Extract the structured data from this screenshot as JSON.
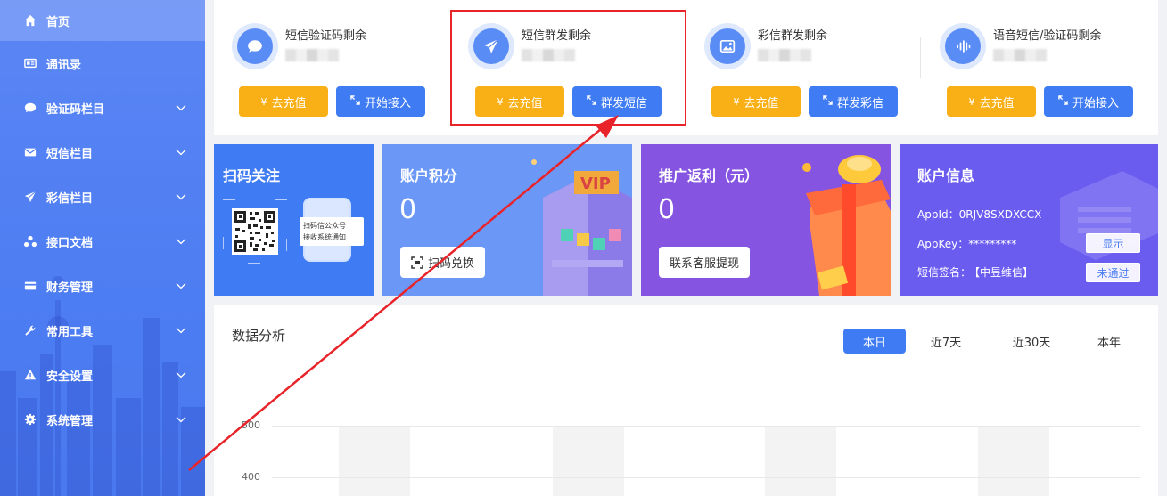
{
  "sidebar": {
    "items": [
      {
        "label": "首页",
        "icon": "home-icon",
        "active": true,
        "has_chevron": false
      },
      {
        "label": "通讯录",
        "icon": "contact-card-icon",
        "active": false,
        "has_chevron": false
      },
      {
        "label": "验证码栏目",
        "icon": "chat-bubble-icon",
        "active": false,
        "has_chevron": true
      },
      {
        "label": "短信栏目",
        "icon": "envelope-icon",
        "active": false,
        "has_chevron": true
      },
      {
        "label": "彩信栏目",
        "icon": "paper-plane-icon",
        "active": false,
        "has_chevron": true
      },
      {
        "label": "接口文档",
        "icon": "network-icon",
        "active": false,
        "has_chevron": true
      },
      {
        "label": "财务管理",
        "icon": "credit-card-icon",
        "active": false,
        "has_chevron": true
      },
      {
        "label": "常用工具",
        "icon": "wrench-icon",
        "active": false,
        "has_chevron": true
      },
      {
        "label": "安全设置",
        "icon": "warning-icon",
        "active": false,
        "has_chevron": true
      },
      {
        "label": "系统管理",
        "icon": "gear-icon",
        "active": false,
        "has_chevron": true
      }
    ]
  },
  "balances": [
    {
      "title": "短信验证码剩余",
      "icon": "chat-bubble-icon",
      "recharge_label": "去充值",
      "action_label": "开始接入"
    },
    {
      "title": "短信群发剩余",
      "icon": "paper-plane-icon",
      "recharge_label": "去充值",
      "action_label": "群发短信"
    },
    {
      "title": "彩信群发剩余",
      "icon": "image-icon",
      "recharge_label": "去充值",
      "action_label": "群发彩信"
    },
    {
      "title": "语音短信/验证码剩余",
      "icon": "voice-wave-icon",
      "recharge_label": "去充值",
      "action_label": "开始接入"
    }
  ],
  "yen_symbol": "¥",
  "qr_card": {
    "title": "扫码关注",
    "phone_text_line1": "扫码信公众号",
    "phone_text_line2": "接收系统通知"
  },
  "points_card": {
    "title": "账户积分",
    "value": "0",
    "button_label": "扫码兑换",
    "banner_text": "VIP"
  },
  "rebate_card": {
    "title": "推广返利（元）",
    "value": "0",
    "button_label": "联系客服提现"
  },
  "account_card": {
    "title": "账户信息",
    "appid_label": "AppId：",
    "appid_value": "0RJV8SXDXCCX",
    "appkey_label": "AppKey：",
    "appkey_value": "*********",
    "sign_label": "短信签名：",
    "sign_value": "【中昱维信】",
    "show_button": "显示",
    "status_button": "未通过"
  },
  "analysis": {
    "title": "数据分析",
    "tabs": [
      {
        "label": "本日",
        "active": true
      },
      {
        "label": "近7天",
        "active": false
      },
      {
        "label": "近30天",
        "active": false
      },
      {
        "label": "本年",
        "active": false
      }
    ],
    "y_ticks": [
      "500",
      "400"
    ]
  },
  "colors": {
    "sidebar": "#4d7df2",
    "yellow_button": "#f9b017",
    "blue_button": "#3f7bf3",
    "qr_card": "#3f7bf3",
    "points_card": "#6b97f7",
    "rebate_card": "#8554e0",
    "account_card": "#6b5cf0",
    "highlight": "#e8232a"
  }
}
